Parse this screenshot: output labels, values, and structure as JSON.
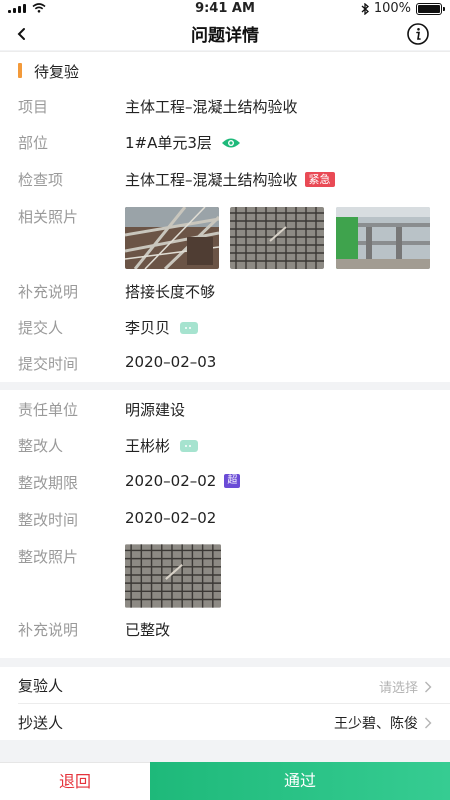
{
  "status_bar": {
    "time": "9:41 AM",
    "battery": "100%",
    "battery_level": 1.0
  },
  "nav": {
    "title": "问题详情",
    "back_icon": "chevron-left-icon",
    "info_icon": "info-icon"
  },
  "issue_status": {
    "label": "待复验",
    "accent_color": "#f39a3a"
  },
  "details": {
    "project": {
      "label": "项目",
      "value": "主体工程–混凝土结构验收"
    },
    "location": {
      "label": "部位",
      "value": "1#A单元3层"
    },
    "check_item": {
      "label": "检查项",
      "value": "主体工程–混凝土结构验收",
      "tag": "紧急"
    },
    "photos": {
      "label": "相关照片"
    },
    "remark": {
      "label": "补充说明",
      "value": "搭接长度不够"
    },
    "submitter": {
      "label": "提交人",
      "value": "李贝贝"
    },
    "submit_time": {
      "label": "提交时间",
      "value": "2020–02–03"
    }
  },
  "rectification": {
    "unit": {
      "label": "责任单位",
      "value": "明源建设"
    },
    "person": {
      "label": "整改人",
      "value": "王彬彬"
    },
    "deadline": {
      "label": "整改期限",
      "value": "2020–02–02",
      "tag": "超"
    },
    "time": {
      "label": "整改时间",
      "value": "2020–02–02"
    },
    "photos": {
      "label": "整改照片"
    },
    "remark": {
      "label": "补充说明",
      "value": "已整改"
    }
  },
  "assign": {
    "reviewer": {
      "label": "复验人",
      "placeholder": "请选择"
    },
    "cc": {
      "label": "抄送人",
      "value": "王少碧、陈俊"
    }
  },
  "actions": {
    "reject": "退回",
    "approve": "通过"
  },
  "colors": {
    "brand_green": "#1eb97a",
    "reject_red": "#e5333c",
    "urgent_red": "#e94a55",
    "overdue_purple": "#6a4bd6"
  }
}
